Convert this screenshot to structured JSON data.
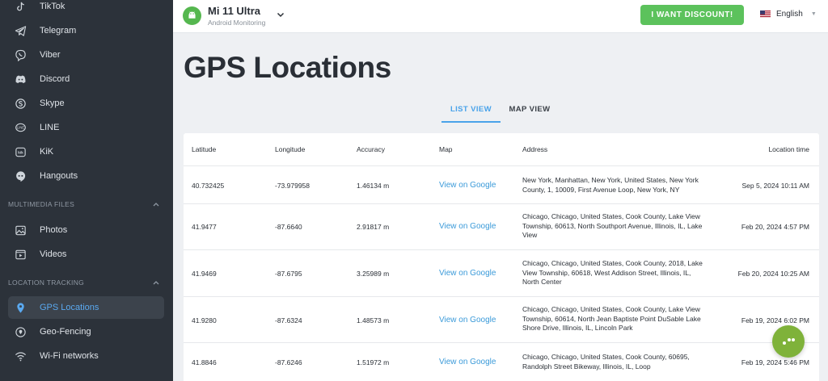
{
  "sidebar": {
    "items_top": [
      {
        "label": "TikTok",
        "icon": "tiktok-icon"
      },
      {
        "label": "Telegram",
        "icon": "telegram-icon"
      },
      {
        "label": "Viber",
        "icon": "viber-icon"
      },
      {
        "label": "Discord",
        "icon": "discord-icon"
      },
      {
        "label": "Skype",
        "icon": "skype-icon"
      },
      {
        "label": "LINE",
        "icon": "line-icon"
      },
      {
        "label": "KiK",
        "icon": "kik-icon"
      },
      {
        "label": "Hangouts",
        "icon": "hangouts-icon"
      }
    ],
    "multimedia": {
      "header": "MULTIMEDIA FILES",
      "items": [
        {
          "label": "Photos",
          "icon": "photos-icon"
        },
        {
          "label": "Videos",
          "icon": "videos-icon"
        }
      ]
    },
    "location": {
      "header": "LOCATION TRACKING",
      "items": [
        {
          "label": "GPS Locations",
          "icon": "location-pin-icon",
          "active": true
        },
        {
          "label": "Geo-Fencing",
          "icon": "geofencing-icon"
        },
        {
          "label": "Wi-Fi networks",
          "icon": "wifi-icon"
        }
      ]
    }
  },
  "topbar": {
    "device_name": "Mi 11 Ultra",
    "device_sub": "Android Monitoring",
    "discount_label": "I WANT DISCOUNT!",
    "language": "English"
  },
  "main": {
    "title": "GPS Locations",
    "tabs": [
      {
        "label": "LIST VIEW",
        "active": true
      },
      {
        "label": "MAP VIEW",
        "active": false
      }
    ]
  },
  "table": {
    "headers": [
      "Latitude",
      "Longitude",
      "Accuracy",
      "Map",
      "Address",
      "Location time"
    ],
    "rows": [
      {
        "lat": "40.732425",
        "lon": "-73.979958",
        "acc": "1.46134 m",
        "map": "View on Google",
        "addr": "New York, Manhattan, New York, United States, New York County, 1, 10009, First Avenue Loop, New York, NY",
        "time": "Sep 5, 2024 10:11 AM"
      },
      {
        "lat": "41.9477",
        "lon": "-87.6640",
        "acc": "2.91817 m",
        "map": "View on Google",
        "addr": "Chicago, Chicago, United States, Cook County, Lake View Township, 60613, North Southport Avenue, Illinois, IL, Lake View",
        "time": "Feb 20, 2024 4:57 PM"
      },
      {
        "lat": "41.9469",
        "lon": "-87.6795",
        "acc": "3.25989 m",
        "map": "View on Google",
        "addr": "Chicago, Chicago, United States, Cook County, 2018, Lake View Township, 60618, West Addison Street, Illinois, IL, North Center",
        "time": "Feb 20, 2024 10:25 AM"
      },
      {
        "lat": "41.9280",
        "lon": "-87.6324",
        "acc": "1.48573 m",
        "map": "View on Google",
        "addr": "Chicago, Chicago, United States, Cook County, Lake View Township, 60614, North Jean Baptiste Point DuSable Lake Shore Drive, Illinois, IL, Lincoln Park",
        "time": "Feb 19, 2024 6:02 PM"
      },
      {
        "lat": "41.8846",
        "lon": "-87.6246",
        "acc": "1.51972 m",
        "map": "View on Google",
        "addr": "Chicago, Chicago, United States, Cook County, 60695, Randolph Street Bikeway, Illinois, IL, Loop",
        "time": "Feb 19, 2024 5:46 PM"
      }
    ]
  },
  "colors": {
    "sidebar_bg": "#2c323a",
    "accent_blue": "#4aa3ea",
    "discount_green": "#5cc25c",
    "android_green": "#55b74f",
    "fab_green": "#7fb23a"
  }
}
